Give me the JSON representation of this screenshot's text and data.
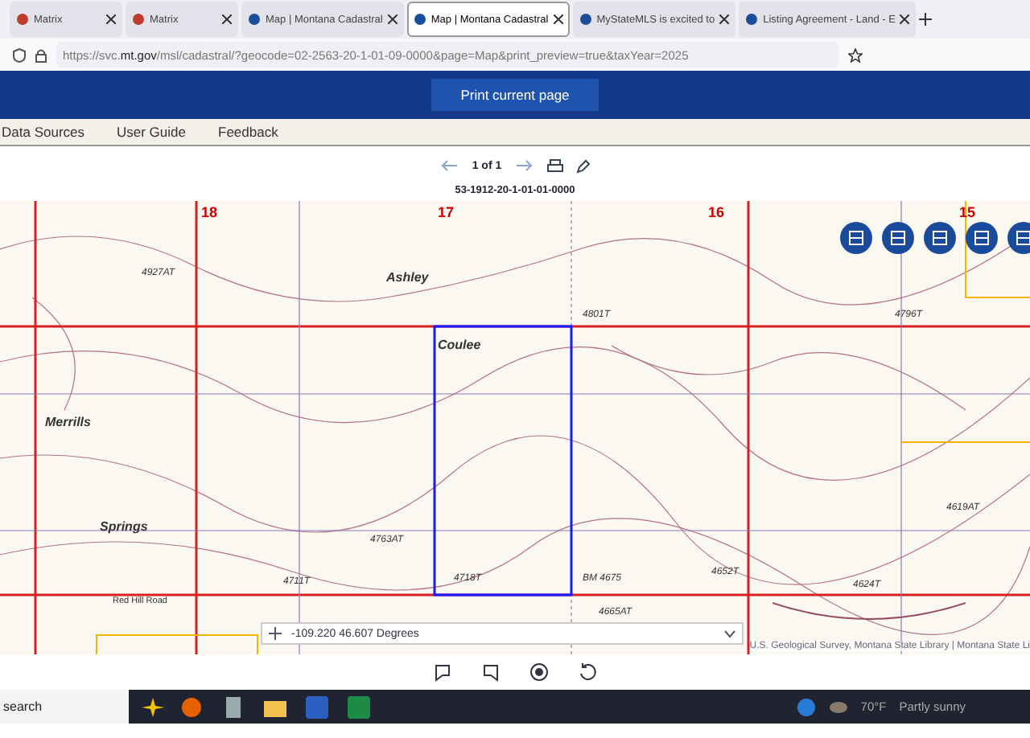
{
  "browser": {
    "tabs": [
      {
        "title": "Matrix",
        "selected": false
      },
      {
        "title": "Matrix",
        "selected": false
      },
      {
        "title": "Map | Montana Cadastral",
        "selected": false
      },
      {
        "title": "Map | Montana Cadastral",
        "selected": true
      },
      {
        "title": "MyStateMLS is excited to",
        "selected": false
      },
      {
        "title": "Listing Agreement - Land - E",
        "selected": false
      }
    ],
    "url_prefix": "https://svc.",
    "url_domain": "mt.gov",
    "url_rest": "/msl/cadastral/?geocode=02-2563-20-1-01-09-0000&page=Map&print_preview=true&taxYear=2025"
  },
  "header": {
    "print_button": "Print current page"
  },
  "nav": [
    "Data Sources",
    "User Guide",
    "Feedback"
  ],
  "pager": {
    "text": "1 of 1"
  },
  "parcel_id": "53-1912-20-1-01-01-0000",
  "map": {
    "labels": [
      {
        "text": "18",
        "kind": "section"
      },
      {
        "text": "17",
        "kind": "section"
      },
      {
        "text": "16",
        "kind": "section"
      },
      {
        "text": "15",
        "kind": "section"
      },
      {
        "text": "4927AT",
        "kind": "elev"
      },
      {
        "text": "Ashley",
        "kind": "name"
      },
      {
        "text": "4801T",
        "kind": "elev"
      },
      {
        "text": "4796T",
        "kind": "elev"
      },
      {
        "text": "Coulee",
        "kind": "name"
      },
      {
        "text": "Merrills",
        "kind": "name"
      },
      {
        "text": "4619AT",
        "kind": "elev"
      },
      {
        "text": "Springs",
        "kind": "name"
      },
      {
        "text": "4763AT",
        "kind": "elev"
      },
      {
        "text": "Red Hill Road",
        "kind": "road"
      },
      {
        "text": "4711T",
        "kind": "elev"
      },
      {
        "text": "4718T",
        "kind": "elev"
      },
      {
        "text": "BM 4675",
        "kind": "elev"
      },
      {
        "text": "4652T",
        "kind": "elev"
      },
      {
        "text": "4624T",
        "kind": "elev"
      },
      {
        "text": "4665AT",
        "kind": "elev"
      }
    ],
    "coordinates": "-109.220 46.607 Degrees",
    "attribution": "U.S. Geological Survey, Montana State Library | Montana State Li"
  },
  "taskbar": {
    "search": "search",
    "temperature": "70°F",
    "weather": "Partly sunny"
  }
}
